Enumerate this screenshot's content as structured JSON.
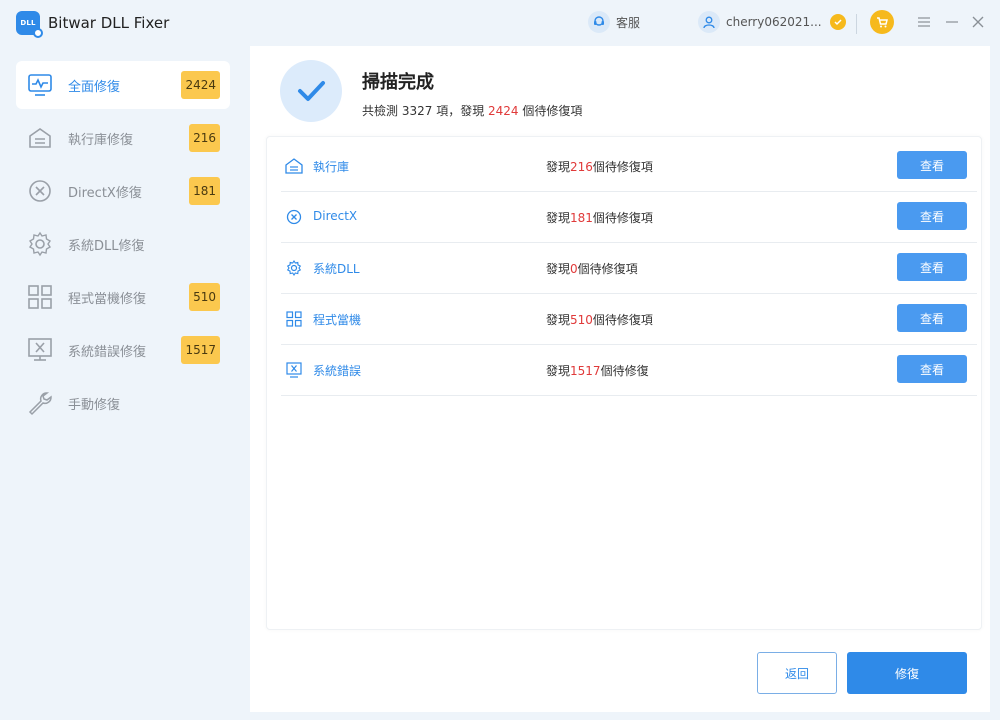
{
  "app": {
    "title": "Bitwar DLL Fixer",
    "logo_text": "DLL",
    "support_label": "客服",
    "username": "cherry062021...",
    "icons": {
      "logo": "dll-app-logo-icon",
      "support": "headset-icon",
      "user": "user-icon",
      "vip": "vip-badge-icon",
      "cart": "cart-icon",
      "menu": "menu-icon",
      "minimize": "minimize-icon",
      "close": "close-icon"
    }
  },
  "sidebar": {
    "items": [
      {
        "label": "全面修復",
        "badge": "2424",
        "icon": "pulse-monitor-icon",
        "active": true
      },
      {
        "label": "執行庫修復",
        "badge": "216",
        "icon": "runtime-library-icon",
        "active": false
      },
      {
        "label": "DirectX修復",
        "badge": "181",
        "icon": "x-circle-icon",
        "active": false
      },
      {
        "label": "系統DLL修復",
        "badge": "",
        "icon": "gear-icon",
        "active": false
      },
      {
        "label": "程式當機修復",
        "badge": "510",
        "icon": "grid-icon",
        "active": false
      },
      {
        "label": "系統錯誤修復",
        "badge": "1517",
        "icon": "monitor-x-icon",
        "active": false
      },
      {
        "label": "手動修復",
        "badge": "",
        "icon": "wrench-icon",
        "active": false
      }
    ]
  },
  "main": {
    "scan_title": "掃描完成",
    "summary": {
      "prefix": "共檢測 ",
      "total": "3327",
      "middle": " 項，發現 ",
      "found": "2424",
      "suffix": " 個待修復項"
    },
    "results": [
      {
        "label": "執行庫",
        "icon": "runtime-library-icon",
        "found_prefix": "發現",
        "count": "216",
        "found_suffix": "個待修復項",
        "button": "查看"
      },
      {
        "label": "DirectX",
        "icon": "x-circle-icon",
        "found_prefix": "發現",
        "count": "181",
        "found_suffix": "個待修復項",
        "button": "查看"
      },
      {
        "label": "系統DLL",
        "icon": "gear-icon",
        "found_prefix": "發現",
        "count": "0",
        "found_suffix": "個待修復項",
        "button": "查看"
      },
      {
        "label": "程式當機",
        "icon": "grid-icon",
        "found_prefix": "發現",
        "count": "510",
        "found_suffix": "個待修復項",
        "button": "查看"
      },
      {
        "label": "系統錯誤",
        "icon": "monitor-x-icon",
        "found_prefix": "發現",
        "count": "1517",
        "found_suffix": "個待修復",
        "button": "查看"
      }
    ],
    "back_label": "返回",
    "fix_label": "修復"
  },
  "colors": {
    "accent": "#2f8ae8",
    "badge": "#fbc84e",
    "highlight_red": "#e03a3a",
    "sidebar_bg": "#eef4fa"
  }
}
